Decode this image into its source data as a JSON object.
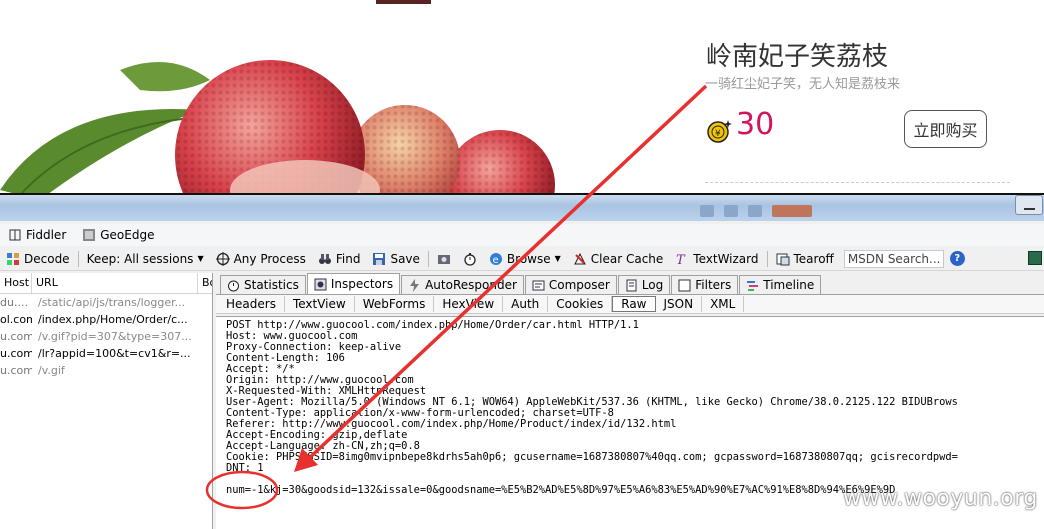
{
  "web": {
    "product_title": "岭南妃子笑荔枝",
    "product_subtitle": "一骑红尘妃子笑，无人知是荔枝来",
    "price": "30",
    "buy_button": "立即购买"
  },
  "menu": {
    "fiddler": "Fiddler",
    "geoedge": "GeoEdge"
  },
  "toolbar": {
    "decode": "Decode",
    "keep": "Keep: All sessions",
    "any_process": "Any Process",
    "find": "Find",
    "save": "Save",
    "browse": "Browse",
    "clear_cache": "Clear Cache",
    "textwizard": "TextWizard",
    "tearoff": "Tearoff",
    "msdn_search": "MSDN Search..."
  },
  "sessions": {
    "col_host": "Host",
    "col_url": "URL",
    "col_body": "Bo",
    "rows": [
      {
        "host": "du....",
        "url": "/static/api/js/trans/logger...",
        "dark": false
      },
      {
        "host": "ol.com",
        "url": "/index.php/Home/Order/c...",
        "dark": true
      },
      {
        "host": "u.com",
        "url": "/v.gif?pid=307&type=307...",
        "dark": false
      },
      {
        "host": "u.com",
        "url": "/lr?appid=100&t=cv1&r=...",
        "dark": true
      },
      {
        "host": "u.com",
        "url": "/v.gif",
        "dark": false
      }
    ]
  },
  "inspector": {
    "tabs": [
      "Statistics",
      "Inspectors",
      "AutoResponder",
      "Composer",
      "Log",
      "Filters",
      "Timeline"
    ],
    "subtabs": [
      "Headers",
      "TextView",
      "WebForms",
      "HexView",
      "Auth",
      "Cookies",
      "Raw",
      "JSON",
      "XML"
    ],
    "raw_lines": [
      "POST http://www.guocool.com/index.php/Home/Order/car.html HTTP/1.1",
      "Host: www.guocool.com",
      "Proxy-Connection: keep-alive",
      "Content-Length: 106",
      "Accept: */*",
      "Origin: http://www.guocool.com",
      "X-Requested-With: XMLHttpRequest",
      "User-Agent: Mozilla/5.0 (Windows NT 6.1; WOW64) AppleWebKit/537.36 (KHTML, like Gecko) Chrome/38.0.2125.122 BIDUBrows",
      "Content-Type: application/x-www-form-urlencoded; charset=UTF-8",
      "Referer: http://www.guocool.com/index.php/Home/Product/index/id/132.html",
      "Accept-Encoding: gzip,deflate",
      "Accept-Language: zh-CN,zh;q=0.8",
      "Cookie: PHPSESSID=8img0mvipnbepe8kdrhs5ah0p6; gcusername=1687380807%40qq.com; gcpassword=1687380807qq; gcisrecordpwd=",
      "DNT: 1",
      "",
      "num=-1&kj=30&goodsid=132&issale=0&goodsname=%E5%B2%AD%E5%8D%97%E5%A6%83%E5%AD%90%E7%AC%91%E8%8D%94%E6%9E%9D"
    ]
  },
  "watermark": "www.wooyun.org",
  "colors": {
    "price": "#d4145a",
    "annotation": "#e8302e"
  }
}
